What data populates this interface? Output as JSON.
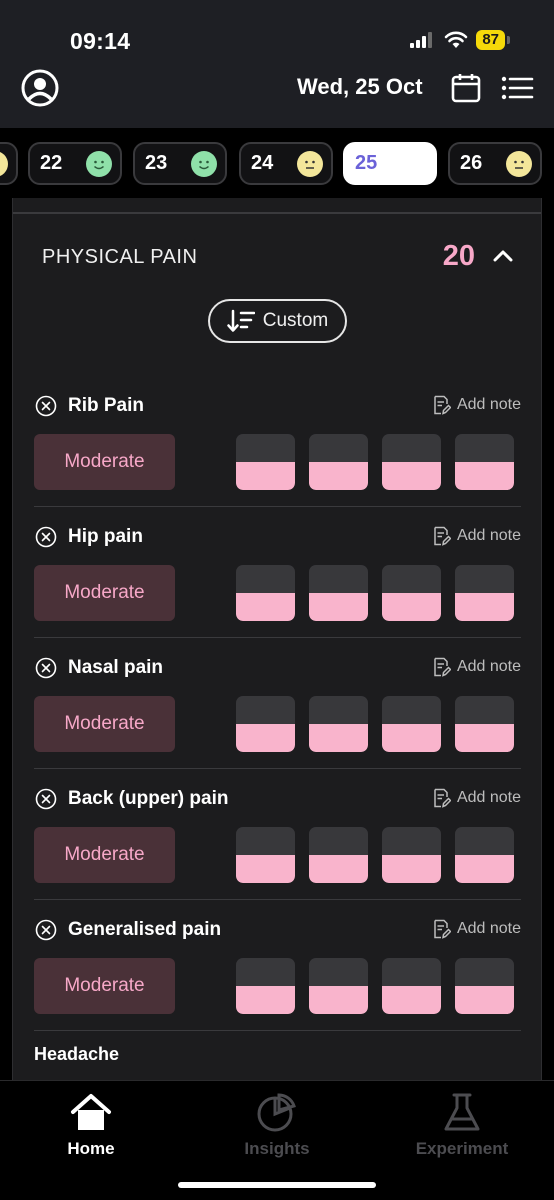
{
  "status_bar": {
    "time": "09:14",
    "battery": "87"
  },
  "header": {
    "date": "Wed, 25 Oct",
    "icons": [
      "profile-icon",
      "calendar-icon",
      "list-menu-icon"
    ]
  },
  "days": [
    {
      "num": "",
      "mood": "yellow"
    },
    {
      "num": "22",
      "mood": "green"
    },
    {
      "num": "23",
      "mood": "green"
    },
    {
      "num": "24",
      "mood": "yellow"
    },
    {
      "num": "25",
      "mood": "",
      "selected": true
    },
    {
      "num": "26",
      "mood": "yellow"
    }
  ],
  "section": {
    "title": "PHYSICAL PAIN",
    "count": "20",
    "sort_label": "Custom"
  },
  "symptoms": [
    {
      "name": "Rib Pain",
      "note_label": "Add note",
      "severity": "Moderate",
      "levels": [
        0.5,
        0.5,
        0.5,
        0.5
      ]
    },
    {
      "name": "Hip pain",
      "note_label": "Add note",
      "severity": "Moderate",
      "levels": [
        0.5,
        0.5,
        0.5,
        0.5
      ]
    },
    {
      "name": "Nasal pain",
      "note_label": "Add note",
      "severity": "Moderate",
      "levels": [
        0.5,
        0.5,
        0.5,
        0.5
      ]
    },
    {
      "name": "Back (upper) pain",
      "note_label": "Add note",
      "severity": "Moderate",
      "levels": [
        0.5,
        0.5,
        0.5,
        0.5
      ]
    },
    {
      "name": "Generalised pain",
      "note_label": "Add note",
      "severity": "Moderate",
      "levels": [
        0.5,
        0.5,
        0.5,
        0.5
      ]
    }
  ],
  "next_symptom": "Headache",
  "tabs": [
    {
      "label": "Home",
      "icon": "home-icon",
      "active": true
    },
    {
      "label": "Insights",
      "icon": "pie-chart-icon",
      "active": false
    },
    {
      "label": "Experiment",
      "icon": "flask-icon",
      "active": false
    }
  ],
  "colors": {
    "accent": "#f7a8c8",
    "selected_day": "#6b62d8",
    "mood_green": "#8fe0a9",
    "mood_yellow": "#f3e69a"
  }
}
